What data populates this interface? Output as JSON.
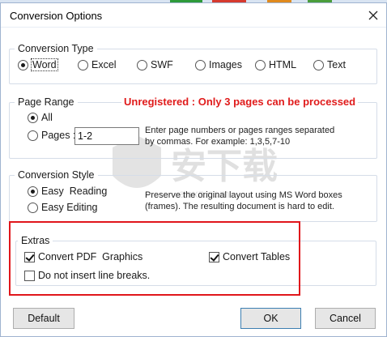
{
  "window": {
    "title": "Conversion Options"
  },
  "conversion_type": {
    "legend": "Conversion Type",
    "options": [
      {
        "label": "Word",
        "selected": true
      },
      {
        "label": "Excel",
        "selected": false
      },
      {
        "label": "SWF",
        "selected": false
      },
      {
        "label": "Images",
        "selected": false
      },
      {
        "label": "HTML",
        "selected": false
      },
      {
        "label": "Text",
        "selected": false
      }
    ]
  },
  "page_range": {
    "legend": "Page Range",
    "warning": "Unregistered : Only 3 pages can be processed",
    "all_label": "All",
    "all_selected": true,
    "pages_label": "Pages :",
    "pages_value": "1-2",
    "help_line1": "Enter page numbers or pages ranges separated",
    "help_line2": "by commas. For example: 1,3,5,7-10"
  },
  "conversion_style": {
    "legend": "Conversion Style",
    "easy_reading_label": "Easy  Reading",
    "easy_reading_selected": true,
    "easy_editing_label": "Easy Editing",
    "easy_editing_selected": false,
    "desc_line1": "Preserve the original layout using MS Word boxes",
    "desc_line2": "(frames). The resulting document is hard to edit."
  },
  "extras": {
    "legend": "Extras",
    "convert_pdf_graphics_label": "Convert PDF  Graphics",
    "convert_pdf_graphics_checked": true,
    "convert_tables_label": "Convert Tables",
    "convert_tables_checked": true,
    "no_line_breaks_label": "Do not insert line breaks.",
    "no_line_breaks_checked": false
  },
  "buttons": {
    "default": "Default",
    "ok": "OK",
    "cancel": "Cancel"
  },
  "colors": {
    "warning": "#e01b1b",
    "highlight_frame": "#e0161b"
  },
  "icons": {
    "close": "close-icon",
    "watermark": "watermark-logo"
  }
}
